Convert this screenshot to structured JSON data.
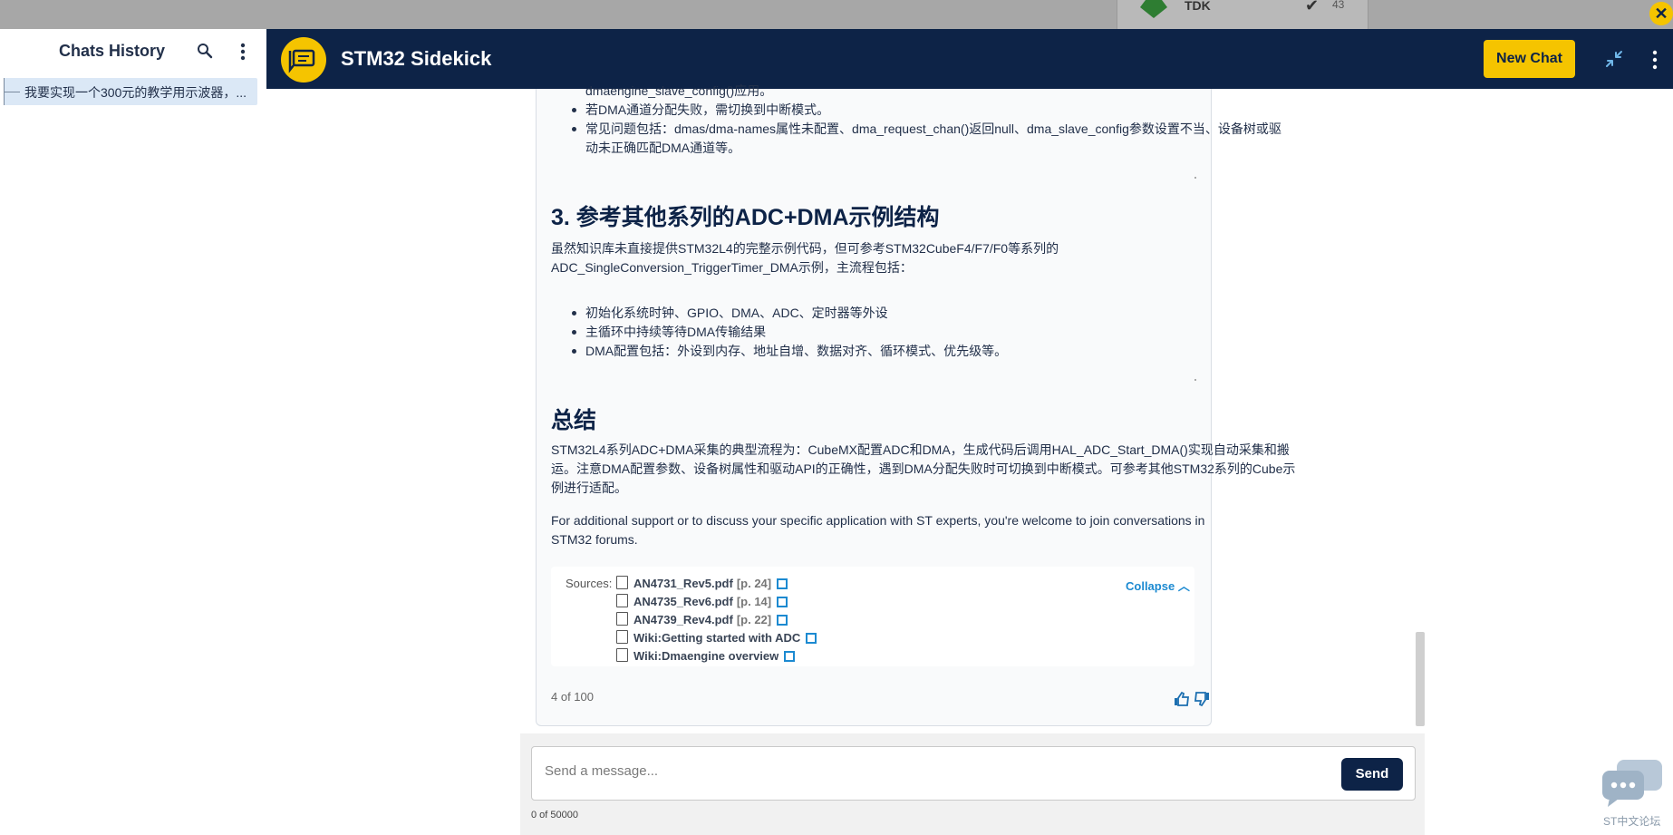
{
  "background": {
    "card_title": "TDK",
    "card_count": "43"
  },
  "sidebar": {
    "title": "Chats History",
    "items": [
      {
        "label": "我要实现一个300元的教学用示波器，..."
      }
    ]
  },
  "header": {
    "title": "STM32 Sidekick",
    "new_chat_label": "New Chat"
  },
  "message": {
    "top_cut": "dmaengine_slave_config()应用。",
    "bullets_top": [
      "若DMA通道分配失败，需切换到中断模式。",
      "常见问题包括：dmas/dma-names属性未配置、dma_request_chan()返回null、dma_slave_config参数设置不当、设备树或驱",
      "动未正确匹配DMA通道等。"
    ],
    "section3": {
      "heading": "3. 参考其他系列的ADC+DMA示例结构",
      "para_lines": [
        "虽然知识库未直接提供STM32L4的完整示例代码，但可参考STM32CubeF4/F7/F0等系列的",
        "ADC_SingleConversion_TriggerTimer_DMA示例，主流程包括："
      ],
      "bullets": [
        "初始化系统时钟、GPIO、DMA、ADC、定时器等外设",
        "主循环中持续等待DMA传输结果",
        "DMA配置包括：外设到内存、地址自增、数据对齐、循环模式、优先级等。"
      ]
    },
    "summary": {
      "heading": "总结",
      "para_lines": [
        "STM32L4系列ADC+DMA采集的典型流程为：CubeMX配置ADC和DMA，生成代码后调用HAL_ADC_Start_DMA()实现自动采集和搬",
        "运。注意DMA配置参数、设备树属性和驱动API的正确性，遇到DMA分配失败时可切换到中断模式。可参考其他STM32系列的Cube示",
        "例进行适配。"
      ]
    },
    "support_lines": [
      "For additional support or to discuss your specific application with ST experts, you're welcome to join conversations in",
      "STM32 forums."
    ],
    "sources": {
      "label": "Sources:",
      "collapse_label": "Collapse",
      "items": [
        {
          "name": "AN4731_Rev5.pdf",
          "page": "[p. 24]"
        },
        {
          "name": "AN4735_Rev6.pdf",
          "page": "[p. 14]"
        },
        {
          "name": "AN4739_Rev4.pdf",
          "page": "[p. 22]"
        },
        {
          "name": "Wiki:Getting started with ADC",
          "page": ""
        },
        {
          "name": "Wiki:Dmaengine overview",
          "page": ""
        }
      ]
    },
    "counter": "4 of 100"
  },
  "composer": {
    "placeholder": "Send a message...",
    "send_label": "Send",
    "char_count": "0 of 50000"
  },
  "forum": {
    "label": "ST中文论坛"
  },
  "colors": {
    "header_bg": "#0d2347",
    "accent": "#f5c400",
    "link": "#1c8ad1"
  }
}
